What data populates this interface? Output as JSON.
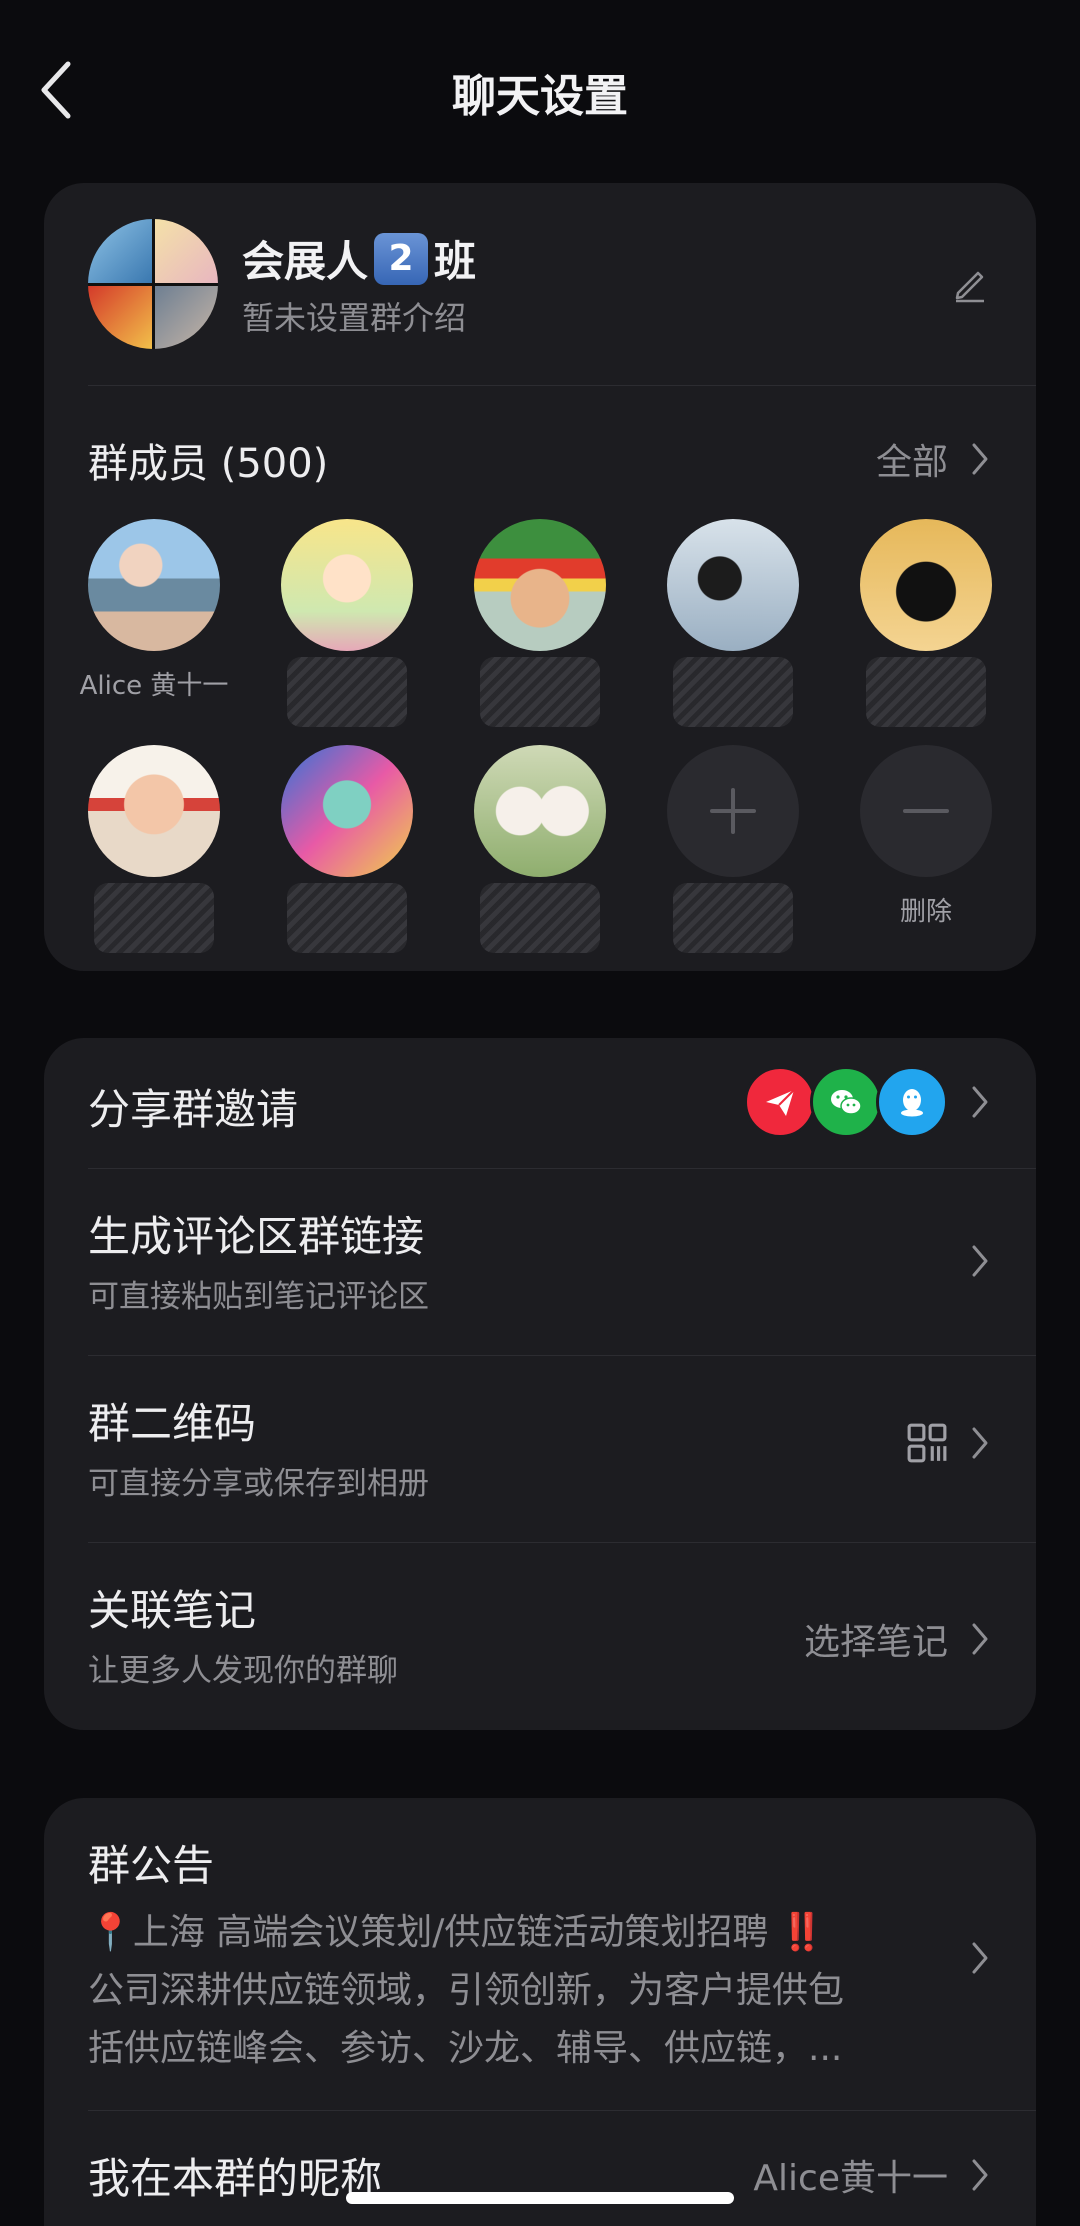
{
  "header": {
    "title": "聊天设置"
  },
  "group": {
    "name": "会展人",
    "name_badge": "2",
    "name_suffix": "班",
    "intro": "暂未设置群介绍"
  },
  "members": {
    "title": "群成员 (500)",
    "all_label": "全部",
    "first_member_name": "Alice 黄十一",
    "delete_label": "删除"
  },
  "share": {
    "invite_label": "分享群邀请",
    "comment_link_title": "生成评论区群链接",
    "comment_link_sub": "可直接粘贴到笔记评论区",
    "qrcode_title": "群二维码",
    "qrcode_sub": "可直接分享或保存到相册",
    "note_title": "关联笔记",
    "note_sub": "让更多人发现你的群聊",
    "note_action": "选择笔记"
  },
  "notice": {
    "title": "群公告",
    "line1": "📍上海 高端会议策划/供应链活动策划招聘 ‼️",
    "line2": "公司深耕供应链领域，引领创新，为客户提供包",
    "line3": "括供应链峰会、参访、沙龙、辅导、供应链，..."
  },
  "nickname": {
    "title": "我在本群的昵称",
    "value": "Alice黄十一"
  },
  "colors": {
    "background": "#0b0b0e",
    "card": "#1c1c20",
    "share_red": "#f0283c",
    "wechat_green": "#1fb24a",
    "qq_blue": "#22a5ee"
  }
}
